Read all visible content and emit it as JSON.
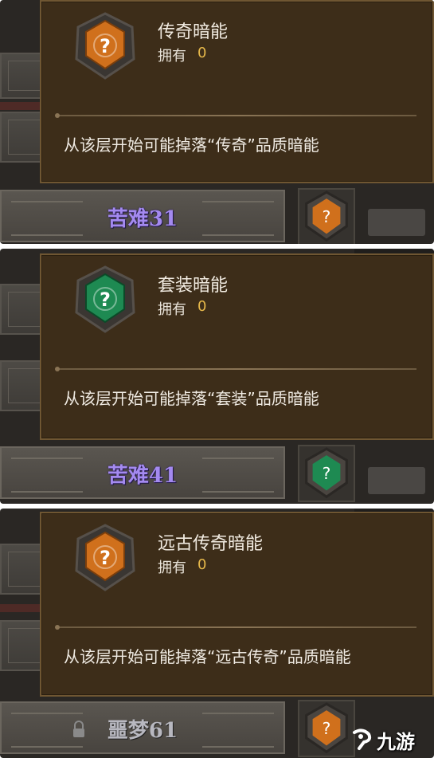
{
  "colors": {
    "legendary": "#c96a18",
    "set": "#1e8a52",
    "ancient": "#c96a18",
    "title_text": "#f2ece2",
    "owned_value": "#e6b84a"
  },
  "panels": [
    {
      "level_label": "苦难31",
      "locked": false,
      "icon": "orange-gem-icon",
      "tooltip": {
        "title": "传奇暗能",
        "owned_label": "拥有",
        "owned_value": "0",
        "description": "从该层开始可能掉落“传奇”品质暗能"
      }
    },
    {
      "level_label": "苦难41",
      "locked": false,
      "icon": "green-gem-icon",
      "tooltip": {
        "title": "套装暗能",
        "owned_label": "拥有",
        "owned_value": "0",
        "description": "从该层开始可能掉落“套装”品质暗能"
      }
    },
    {
      "level_label": "噩梦61",
      "locked": true,
      "icon": "orange-gem-icon",
      "tooltip": {
        "title": "远古传奇暗能",
        "owned_label": "拥有",
        "owned_value": "0",
        "description": "从该层开始可能掉落“远古传奇”品质暗能"
      }
    }
  ],
  "watermark": {
    "text": "九游"
  }
}
